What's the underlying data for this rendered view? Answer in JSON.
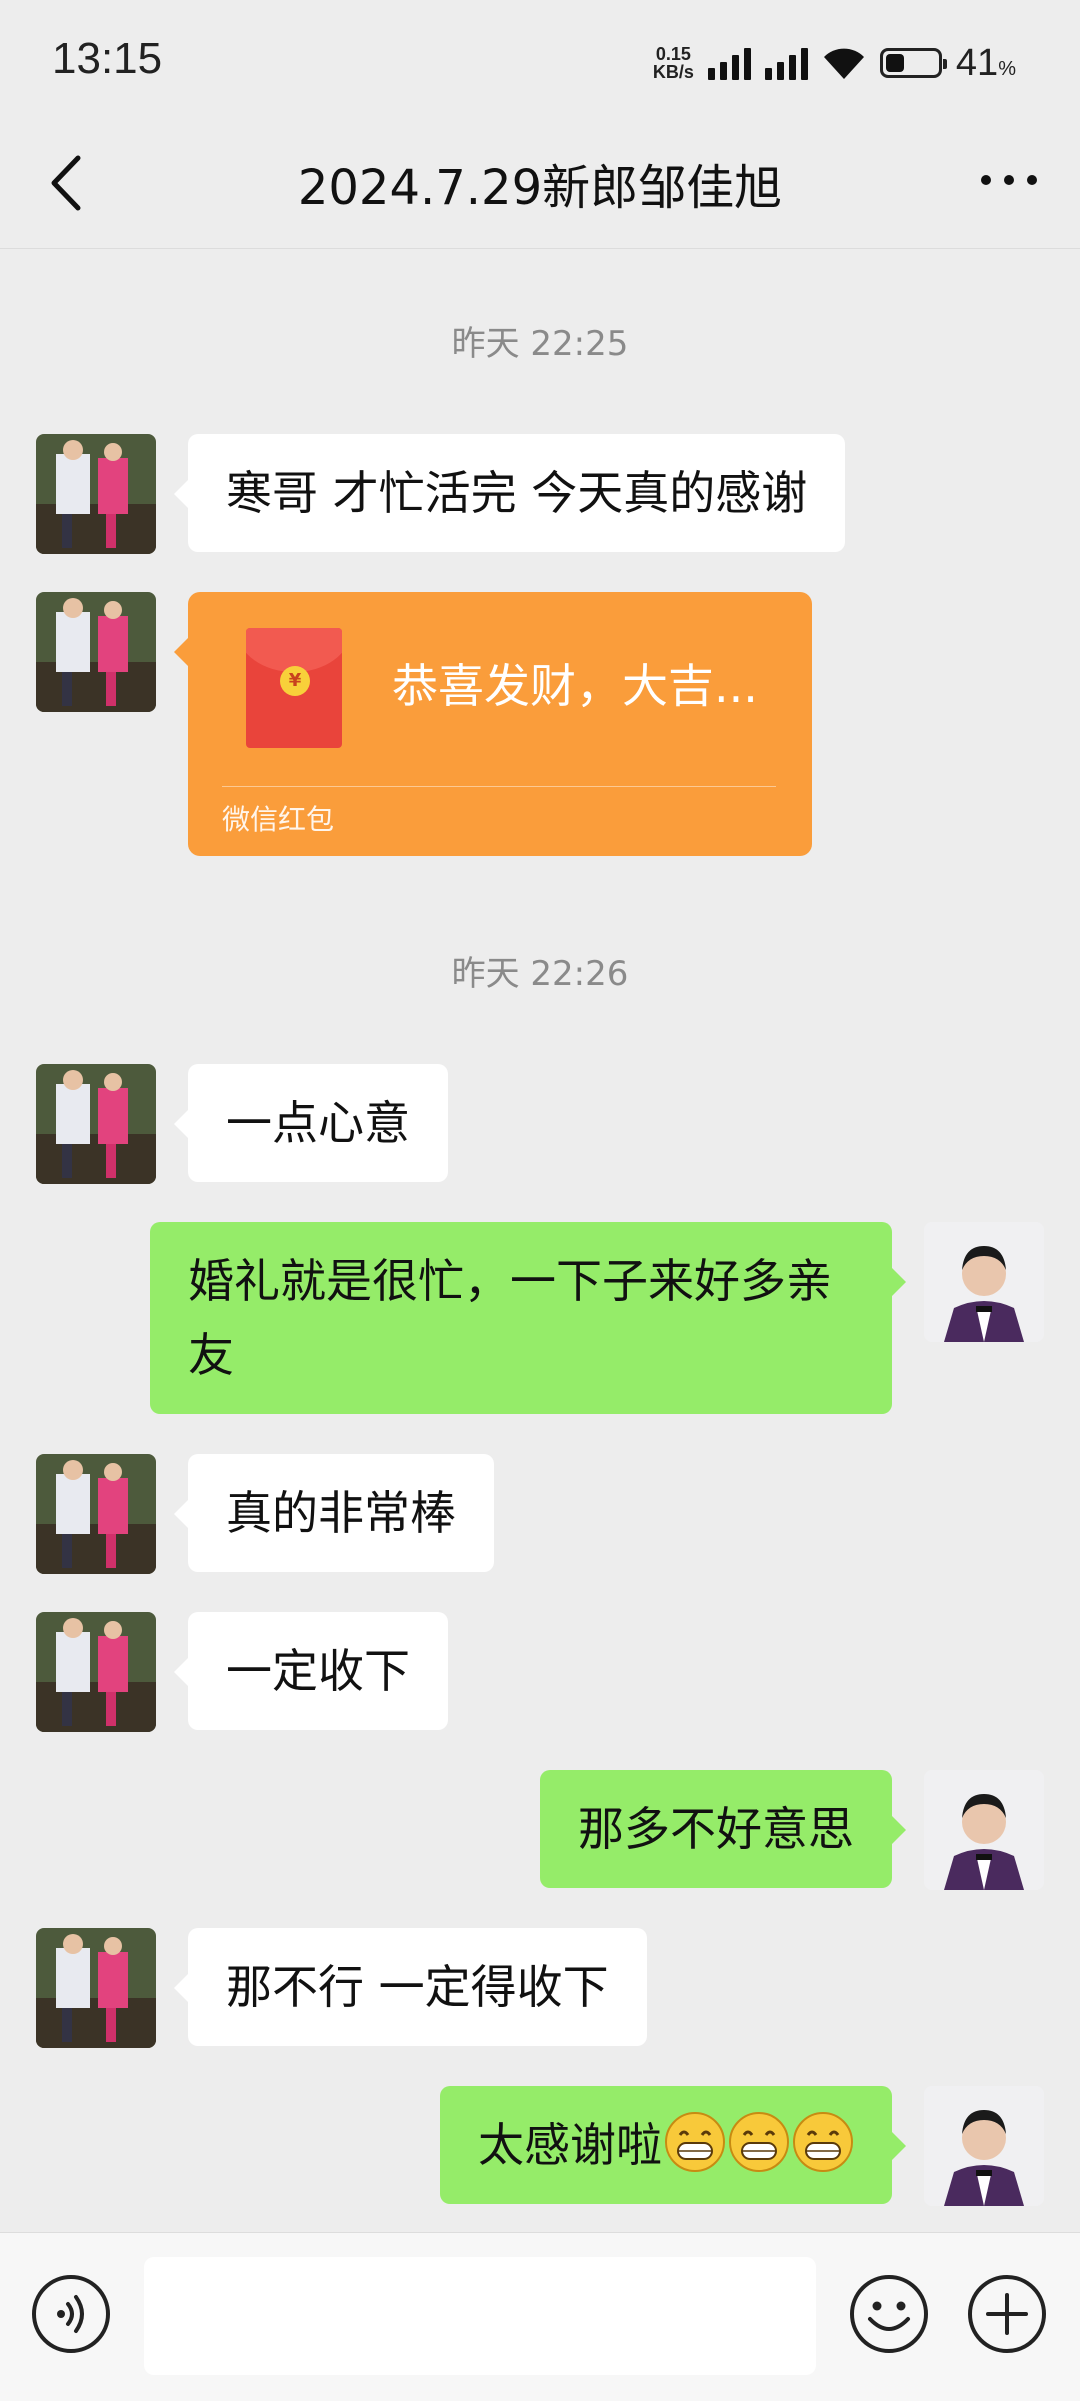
{
  "status_bar": {
    "time": "13:15",
    "net_speed_value": "0.15",
    "net_speed_unit": "KB/s",
    "battery_level": "41",
    "battery_unit": "%"
  },
  "nav": {
    "title": "2024.7.29新郎邹佳旭"
  },
  "messages": {
    "ts1": "昨天 22:25",
    "m1": "寒哥  才忙活完 今天真的感谢",
    "redpacket_title": "恭喜发财，大吉...",
    "redpacket_footer": "微信红包",
    "ts2": "昨天 22:26",
    "m2": "一点心意",
    "m3": "婚礼就是很忙，一下子来好多亲友",
    "m4": "真的非常棒",
    "m5": "一定收下",
    "m6": "那多不好意思",
    "m7": "那不行  一定得收下",
    "m8": "太感谢啦"
  },
  "input": {
    "value": ""
  },
  "colors": {
    "background": "#ededed",
    "bubble_left": "#ffffff",
    "bubble_right": "#95ec69",
    "redpacket": "#fa9d3b",
    "timestamp": "#8a8a8a"
  }
}
